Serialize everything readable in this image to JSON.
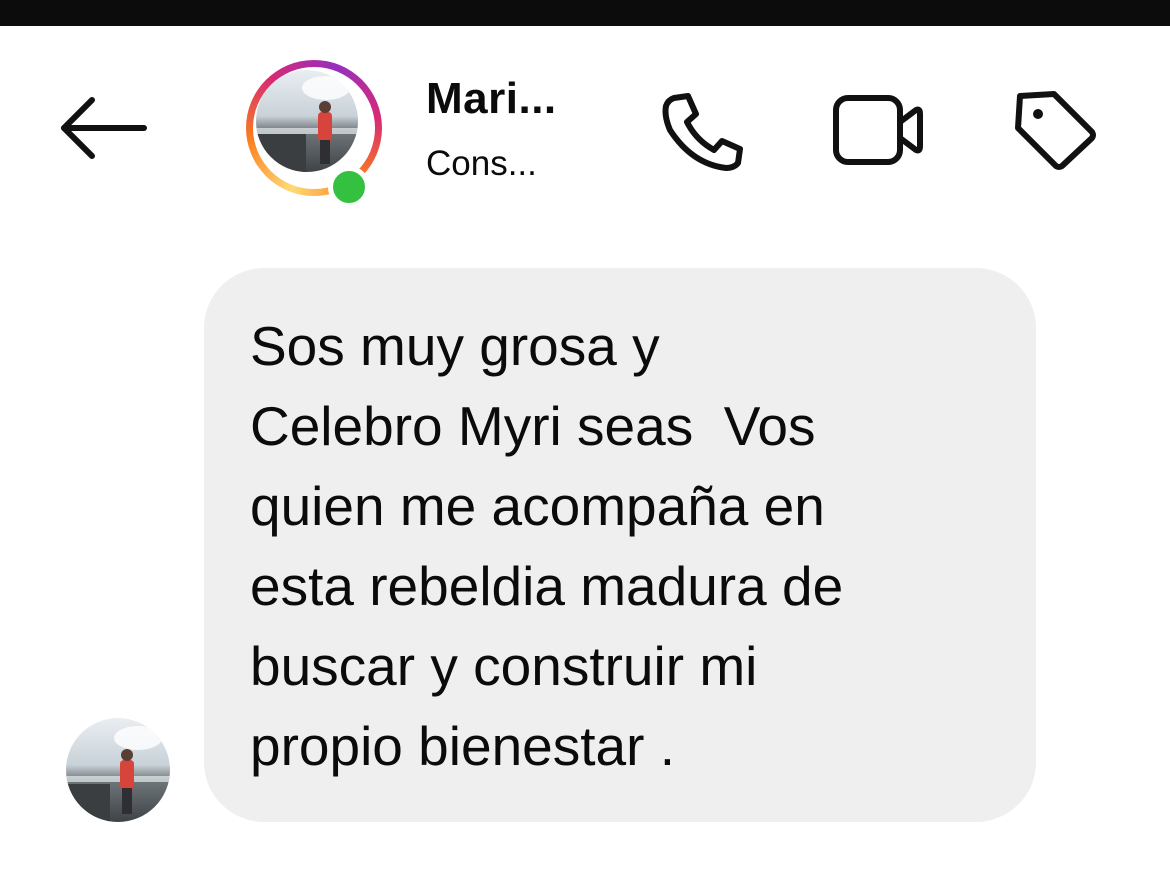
{
  "header": {
    "contact_name": "Mari...",
    "contact_status": "Cons...",
    "icons": {
      "back": "arrow-left-icon",
      "call": "phone-icon",
      "video": "video-camera-icon",
      "label": "tag-icon"
    },
    "colors": {
      "online": "#33c13f",
      "ring": [
        "#feda75",
        "#fa7e1e",
        "#d62976",
        "#962fbf"
      ]
    }
  },
  "message": {
    "lines": [
      "Sos muy grosa y",
      "Celebro Myri seas  Vos",
      "quien me acompaña en",
      "esta rebeldia madura de",
      "buscar y construir mi",
      "propio bienestar ."
    ],
    "bubble_color": "#efefef"
  }
}
